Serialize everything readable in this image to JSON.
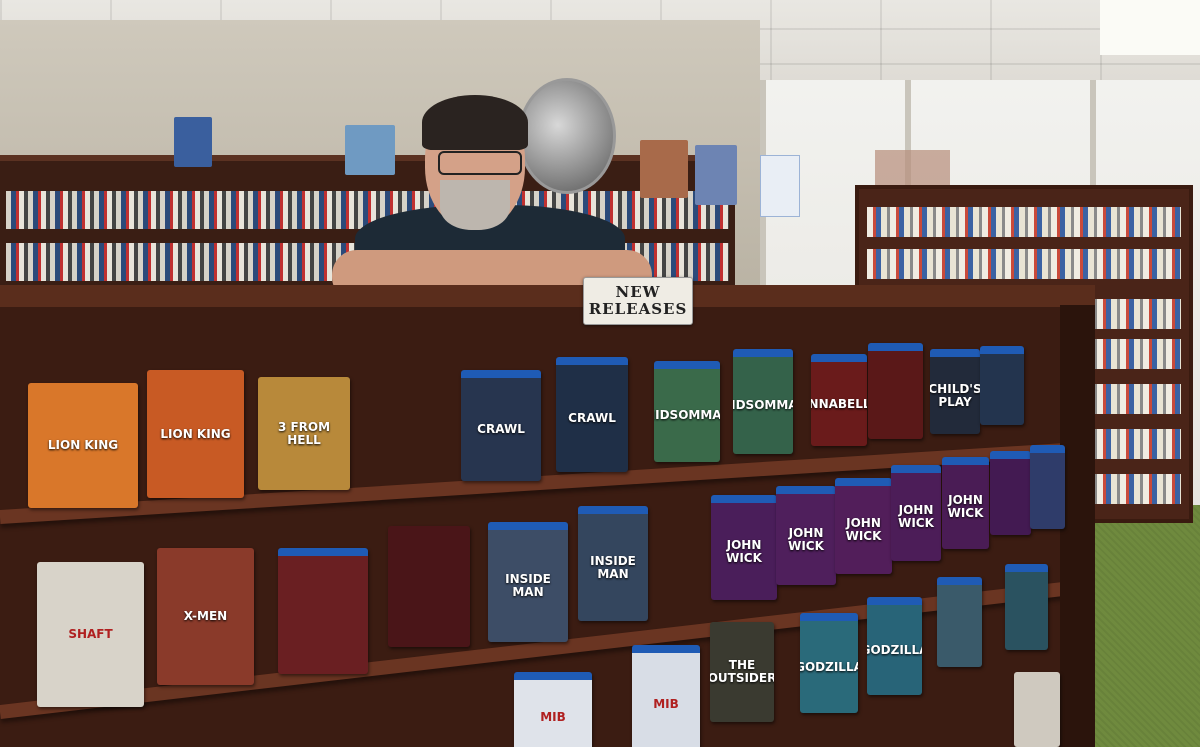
{
  "scene": {
    "colors": {
      "shelf_wood": "#3b1c12",
      "carpet": "#6f8a3e",
      "wall": "#cfc9bc"
    }
  },
  "sign": {
    "line1": "NEW",
    "line2": "RELEASES"
  },
  "dvds": [
    {
      "title": "LION KING",
      "color": "#d9772a"
    },
    {
      "title": "LION KING",
      "color": "#c85a24"
    },
    {
      "title": "3 FROM HELL",
      "color": "#b8893a"
    },
    {
      "title": "CRAWL",
      "color": "#27354f"
    },
    {
      "title": "CRAWL",
      "color": "#1f2f47"
    },
    {
      "title": "MIDSOMMAR",
      "color": "#3a6a4a"
    },
    {
      "title": "MIDSOMMAR",
      "color": "#34624a"
    },
    {
      "title": "ANNABELLE",
      "color": "#6a1b1b"
    },
    {
      "title": "",
      "color": "#5a1818"
    },
    {
      "title": "CHILD'S PLAY",
      "color": "#222a3a"
    },
    {
      "title": "",
      "color": "#23344e"
    },
    {
      "title": "SHAFT",
      "color": "#d8d3c9"
    },
    {
      "title": "X-MEN",
      "color": "#8a3a2a"
    },
    {
      "title": "",
      "color": "#6a1f22"
    },
    {
      "title": "",
      "color": "#4a1518"
    },
    {
      "title": "INSIDE MAN",
      "color": "#3d4d66"
    },
    {
      "title": "INSIDE MAN",
      "color": "#34465e"
    },
    {
      "title": "JOHN WICK",
      "color": "#4a1e5a"
    },
    {
      "title": "JOHN WICK",
      "color": "#4f1f5c"
    },
    {
      "title": "JOHN WICK",
      "color": "#521e5a"
    },
    {
      "title": "JOHN WICK",
      "color": "#4c1d58"
    },
    {
      "title": "JOHN WICK",
      "color": "#4a1c55"
    },
    {
      "title": "",
      "color": "#431a52"
    },
    {
      "title": "",
      "color": "#2f3c6a"
    },
    {
      "title": "GODZILLA",
      "color": "#2a6a7a"
    },
    {
      "title": "GODZILLA",
      "color": "#286478"
    },
    {
      "title": "",
      "color": "#3a5a6a"
    },
    {
      "title": "",
      "color": "#2a5260"
    },
    {
      "title": "THE OUTSIDER",
      "color": "#3a3a30"
    },
    {
      "title": "MIB",
      "color": "#dfe3ea"
    },
    {
      "title": "MIB",
      "color": "#d8dde6"
    },
    {
      "title": "",
      "color": "#cfc9bf"
    }
  ]
}
